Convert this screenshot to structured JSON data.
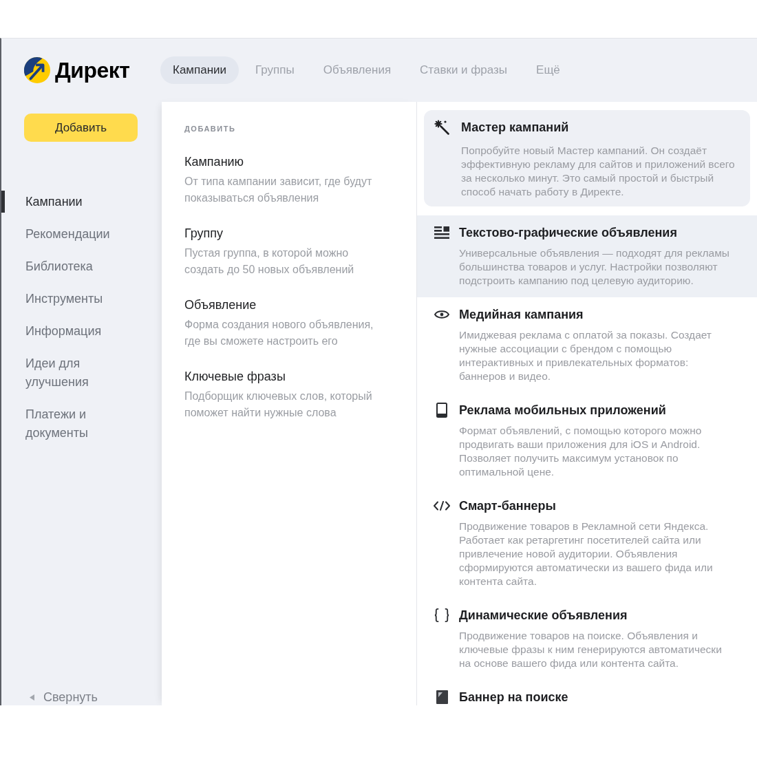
{
  "header": {
    "logo": "Директ",
    "tabs": [
      {
        "label": "Кампании",
        "selected": true
      },
      {
        "label": "Группы",
        "selected": false
      },
      {
        "label": "Объявления",
        "selected": false
      },
      {
        "label": "Ставки и фразы",
        "selected": false
      },
      {
        "label": "Ещё",
        "selected": false
      }
    ]
  },
  "sidebar": {
    "add_button": "Добавить",
    "items": [
      {
        "label": "Кампании",
        "selected": true
      },
      {
        "label": "Рекомендации",
        "selected": false
      },
      {
        "label": "Библиотека",
        "selected": false
      },
      {
        "label": "Инструменты",
        "selected": false
      },
      {
        "label": "Информация",
        "selected": false
      },
      {
        "label": "Идеи для улучшения",
        "selected": false
      },
      {
        "label": "Платежи и документы",
        "selected": false
      }
    ],
    "collapse": "Свернуть"
  },
  "add_menu": {
    "heading": "ДОБАВИТЬ",
    "items": [
      {
        "title": "Кампанию",
        "description": "От типа кампании зависит, где будут показываться объявления"
      },
      {
        "title": "Группу",
        "description": "Пустая группа, в которой можно создать до 50 новых объявлений"
      },
      {
        "title": "Объявление",
        "description": "Форма создания нового объявления, где вы сможете настроить его"
      },
      {
        "title": "Ключевые фразы",
        "description": "Подборщик ключевых слов, который поможет найти нужные слова"
      }
    ]
  },
  "campaign_types": {
    "items": [
      {
        "kind": "card",
        "highlighted": false,
        "title": "Мастер кампаний",
        "description": "Попробуйте новый Мастер кампаний. Он создаёт эффективную рекламу для сайтов и приложений всего за несколько минут. Это самый простой и быстрый способ начать работу в Директе."
      },
      {
        "kind": "option",
        "highlighted": true,
        "title": "Текстово-графические объявления",
        "description": "Универсальные объявления — подходят для рекламы большинства товаров и услуг. Настройки позволяют подстроить кампанию под целевую аудиторию."
      },
      {
        "kind": "option",
        "highlighted": false,
        "title": "Медийная кампания",
        "description": "Имиджевая реклама с оплатой за показы. Создает нужные ассоциации с брендом с помощью интерактивных и привлекательных форматов: баннеров и видео."
      },
      {
        "kind": "option",
        "highlighted": false,
        "title": "Реклама мобильных приложений",
        "description": "Формат объявлений, с помощью которого можно продвигать ваши приложения для iOS и Android. Позволяет получить максимум установок по оптимальной цене."
      },
      {
        "kind": "option",
        "highlighted": false,
        "title": "Смарт-баннеры",
        "description": "Продвижение товаров в Рекламной сети Яндекса. Работает как ретаргетинг посетителей сайта или привлечение новой аудитории. Объявления сформируются автоматически из вашего фида или контента сайта."
      },
      {
        "kind": "option",
        "highlighted": false,
        "title": "Динамические объявления",
        "description": "Продвижение товаров на поиске. Объявления и ключевые фразы к ним генерируются автоматически на основе вашего фида или контента сайта."
      },
      {
        "kind": "option",
        "highlighted": false,
        "title": "Баннер на поиске"
      }
    ]
  }
}
